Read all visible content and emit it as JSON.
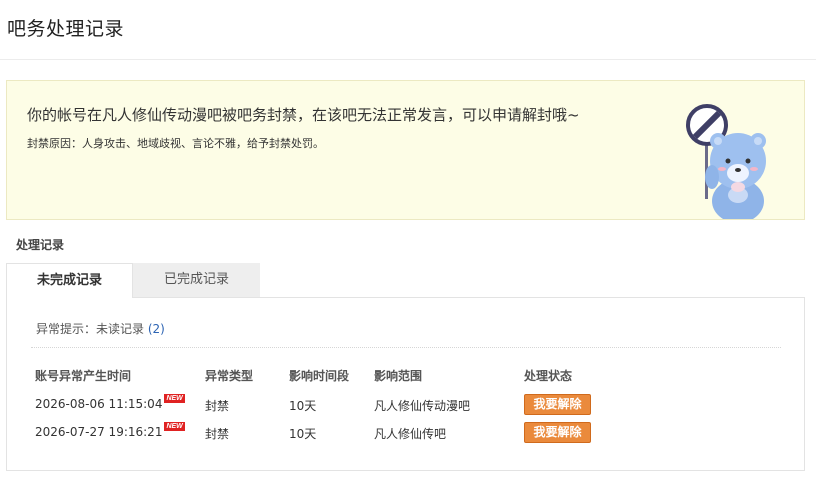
{
  "page": {
    "title": "吧务处理记录"
  },
  "notice": {
    "main_text": "你的帐号在凡人修仙传动漫吧被吧务封禁，在该吧无法正常发言，可以申请解封哦~",
    "reason_text": "封禁原因：人身攻击、地域歧视、言论不雅，给予封禁处罚。"
  },
  "section": {
    "heading": "处理记录"
  },
  "tabs": [
    {
      "label": "未完成记录",
      "active": true
    },
    {
      "label": "已完成记录",
      "active": false
    }
  ],
  "unread": {
    "label": "异常提示：未读记录",
    "count": "(2)"
  },
  "table": {
    "headers": [
      "账号异常产生时间",
      "异常类型",
      "影响时间段",
      "影响范围",
      "处理状态"
    ],
    "new_badge": "NEW",
    "rows": [
      {
        "time": "2026-08-06 11:15:04",
        "type": "封禁",
        "duration": "10天",
        "scope": "凡人修仙传动漫吧",
        "action": "我要解除"
      },
      {
        "time": "2026-07-27 19:16:21",
        "type": "封禁",
        "duration": "10天",
        "scope": "凡人修仙传吧",
        "action": "我要解除"
      }
    ]
  },
  "colors": {
    "notice_bg": "#fdfde6",
    "button_orange": "#ea8a3c",
    "link_blue": "#2d64b3",
    "badge_red": "#e02222"
  },
  "icons": {
    "mascot": "bear-holding-no-sign-icon"
  }
}
